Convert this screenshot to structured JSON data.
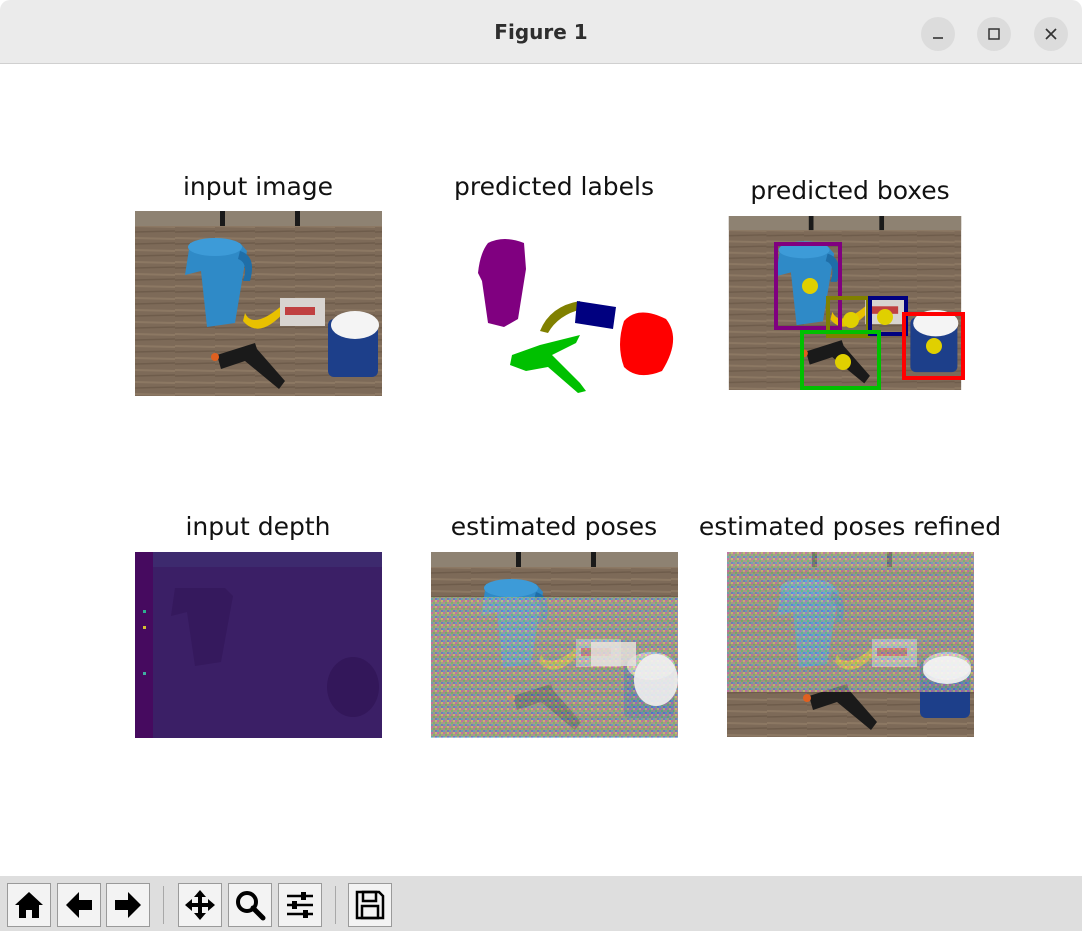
{
  "window": {
    "title": "Figure 1",
    "controls": [
      "minimize-icon",
      "maximize-icon",
      "close-icon"
    ]
  },
  "figure": {
    "panels": [
      {
        "id": "input-image",
        "title": "input image"
      },
      {
        "id": "predicted-labels",
        "title": "predicted labels"
      },
      {
        "id": "predicted-boxes",
        "title": "predicted boxes"
      },
      {
        "id": "input-depth",
        "title": "input depth"
      },
      {
        "id": "estimated-poses",
        "title": "estimated poses"
      },
      {
        "id": "estimated-poses-refined",
        "title": "estimated poses refined"
      }
    ],
    "label_colors": {
      "pitcher": "#800080",
      "banana": "#808000",
      "box": "#000080",
      "can": "#ff0000",
      "clamp": "#00c000"
    },
    "center_marker_color": "#e0d000"
  },
  "toolbar": {
    "buttons": [
      {
        "icon": "home-icon",
        "tooltip": "Home"
      },
      {
        "icon": "back-arrow-icon",
        "tooltip": "Back"
      },
      {
        "icon": "forward-arrow-icon",
        "tooltip": "Forward"
      },
      {
        "icon": "pan-icon",
        "tooltip": "Pan"
      },
      {
        "icon": "zoom-icon",
        "tooltip": "Zoom"
      },
      {
        "icon": "subplots-icon",
        "tooltip": "Subplots"
      },
      {
        "icon": "save-icon",
        "tooltip": "Save"
      }
    ]
  }
}
